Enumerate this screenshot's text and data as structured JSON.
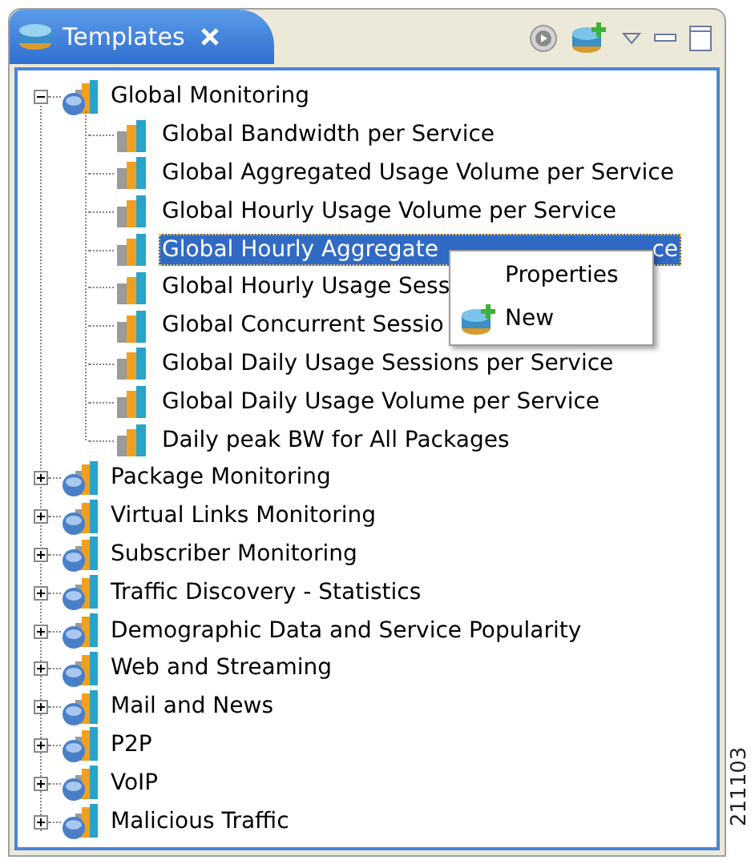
{
  "view": {
    "tab": {
      "title": "Templates",
      "selected": true
    },
    "tree": [
      {
        "label": "Global Monitoring",
        "expanded": true,
        "selected": false,
        "children": [
          {
            "label": "Global Bandwidth per Service",
            "selected": false
          },
          {
            "label": "Global Aggregated Usage Volume per Service",
            "selected": false
          },
          {
            "label": "Global Hourly Usage Volume per Service",
            "selected": false
          },
          {
            "label": "Global Hourly Aggregate",
            "label_tail": "ce",
            "selected": true
          },
          {
            "label": "Global Hourly Usage Sess",
            "selected": false
          },
          {
            "label": "Global Concurrent Sessio",
            "selected": false
          },
          {
            "label": "Global Daily Usage Sessions per Service",
            "selected": false
          },
          {
            "label": "Global Daily Usage Volume per Service",
            "selected": false
          },
          {
            "label": "Daily peak BW for All Packages",
            "selected": false
          }
        ]
      },
      {
        "label": "Package Monitoring",
        "expanded": false,
        "selected": false
      },
      {
        "label": "Virtual Links Monitoring",
        "expanded": false,
        "selected": false
      },
      {
        "label": "Subscriber Monitoring",
        "expanded": false,
        "selected": false
      },
      {
        "label": "Traffic Discovery - Statistics",
        "expanded": false,
        "selected": false
      },
      {
        "label": "Demographic Data and Service Popularity",
        "expanded": false,
        "selected": false
      },
      {
        "label": "Web and Streaming",
        "expanded": false,
        "selected": false
      },
      {
        "label": "Mail and News",
        "expanded": false,
        "selected": false
      },
      {
        "label": "P2P",
        "expanded": false,
        "selected": false
      },
      {
        "label": "VoIP",
        "expanded": false,
        "selected": false
      },
      {
        "label": "Malicious Traffic",
        "expanded": false,
        "selected": false
      }
    ],
    "context_menu": {
      "items": [
        {
          "label": "Properties",
          "kind": "plain"
        },
        {
          "label": "New",
          "kind": "icon"
        }
      ]
    }
  },
  "figure_id": "211103"
}
